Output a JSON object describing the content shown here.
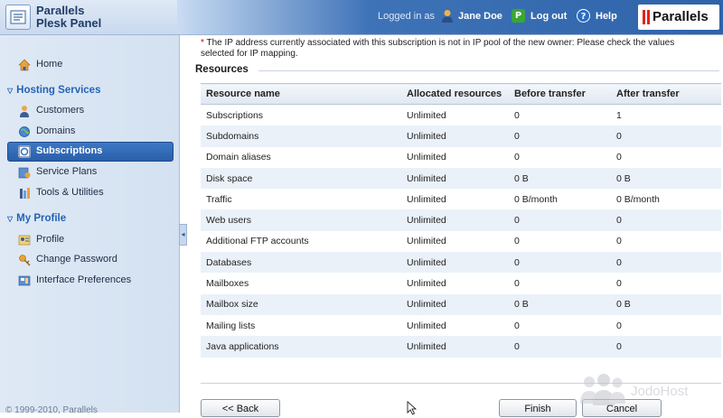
{
  "app": {
    "title_line1": "Parallels",
    "title_line2": "Plesk Panel",
    "logged_in_label": "Logged in as",
    "user_name": "Jane Doe",
    "logout_label": "Log out",
    "help_label": "Help",
    "brand": "Parallels"
  },
  "sidebar": {
    "home": "Home",
    "hosting_section": "Hosting Services",
    "hosting_items": [
      "Customers",
      "Domains",
      "Subscriptions",
      "Service Plans",
      "Tools & Utilities"
    ],
    "active_item": "Subscriptions",
    "profile_section": "My Profile",
    "profile_items": [
      "Profile",
      "Change Password",
      "Interface Preferences"
    ],
    "copyright": "© 1999-2010, Parallels"
  },
  "main": {
    "warning_star": "*",
    "warning_text": "The IP address currently associated with this subscription is not in IP pool of the new owner: Please check the values selected for IP mapping.",
    "section_title": "Resources",
    "table": {
      "headers": [
        "Resource name",
        "Allocated resources",
        "Before transfer",
        "After transfer"
      ],
      "rows": [
        [
          "Subscriptions",
          "Unlimited",
          "0",
          "1"
        ],
        [
          "Subdomains",
          "Unlimited",
          "0",
          "0"
        ],
        [
          "Domain aliases",
          "Unlimited",
          "0",
          "0"
        ],
        [
          "Disk space",
          "Unlimited",
          "0 B",
          "0 B"
        ],
        [
          "Traffic",
          "Unlimited",
          "0 B/month",
          "0 B/month"
        ],
        [
          "Web users",
          "Unlimited",
          "0",
          "0"
        ],
        [
          "Additional FTP accounts",
          "Unlimited",
          "0",
          "0"
        ],
        [
          "Databases",
          "Unlimited",
          "0",
          "0"
        ],
        [
          "Mailboxes",
          "Unlimited",
          "0",
          "0"
        ],
        [
          "Mailbox size",
          "Unlimited",
          "0 B",
          "0 B"
        ],
        [
          "Mailing lists",
          "Unlimited",
          "0",
          "0"
        ],
        [
          "Java applications",
          "Unlimited",
          "0",
          "0"
        ]
      ]
    },
    "buttons": {
      "back": "<< Back",
      "finish": "Finish",
      "cancel": "Cancel"
    }
  },
  "watermark": "JodoHost",
  "colors": {
    "accent": "#2463b5",
    "active_nav": "#2a5fa9",
    "row_alt": "#eaf1f9",
    "warning_star": "#d00000"
  }
}
